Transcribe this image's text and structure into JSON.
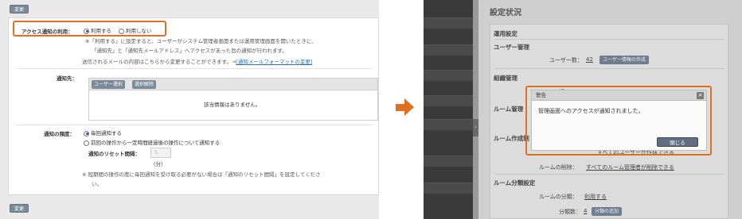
{
  "left": {
    "top_button": "変更",
    "bottom_button": "変更",
    "access_notice": {
      "label": "アクセス通知の利用：",
      "options": [
        "利用する",
        "利用しない"
      ],
      "selected": "利用する",
      "note_line1": "※「利用する」に設定すると、ユーザーがシステム管理者画面または運用管理画面を開いたときに、",
      "note_line2": "「通知先」と「通知先メールアドレス」へアクセスがあった旨の通知が行われます。",
      "mail_line": "送信されるメールの内容はこちらから変更することができます。→",
      "mail_link": "[通知メールフォーマットの変更]"
    },
    "recipients": {
      "label": "通知先：",
      "select_user_button": "ユーザー選択",
      "deselect_button": "選択解除",
      "empty_text": "該当情報はありません。"
    },
    "frequency": {
      "label": "通知の頻度：",
      "options": [
        "毎回通知する",
        "前回の操作から一定時間経過後の操作について通知する"
      ],
      "selected": "毎回通知する",
      "reset_label": "通知のリセット間隔：",
      "reset_value": "5",
      "reset_unit": "（分）",
      "note_line1": "※ 短期間の操作の度に毎回通知を受け取る必要がない場合は「通知のリセット間隔」を設定してくださ",
      "note_line2": "い。"
    }
  },
  "right": {
    "page_title": "設定状況",
    "section_operation": "運用設定",
    "user_mgmt": {
      "heading": "ユーザー管理",
      "count_label": "ユーザー数：",
      "count_value": "42",
      "create_button": "ユーザー情報の作成"
    },
    "org_mgmt": {
      "heading": "組織管理",
      "count_label": "組"
    },
    "room_mgmt": {
      "heading": "ルーム管理"
    },
    "room_create": {
      "heading": "ルーム作成制",
      "partial_text": "すべてのユーザーが作成できる"
    },
    "room_delete": {
      "label": "ルームの削除：",
      "value": "すべてのルーム管理者が削除できる"
    },
    "room_category": {
      "heading": "ルーム分類設定",
      "use_label": "ルームの分類：",
      "use_value": "利用する",
      "count_label": "分類数：",
      "count_value": "4",
      "add_button": "分類の追加"
    },
    "dialog": {
      "title": "警告",
      "message": "管理画面へのアクセスが通知されました。",
      "close_button": "閉じる",
      "close_icon": "×"
    },
    "splitter_icon": "‹"
  },
  "colors": {
    "highlight": "#e07020",
    "link": "#2a6fb5"
  }
}
